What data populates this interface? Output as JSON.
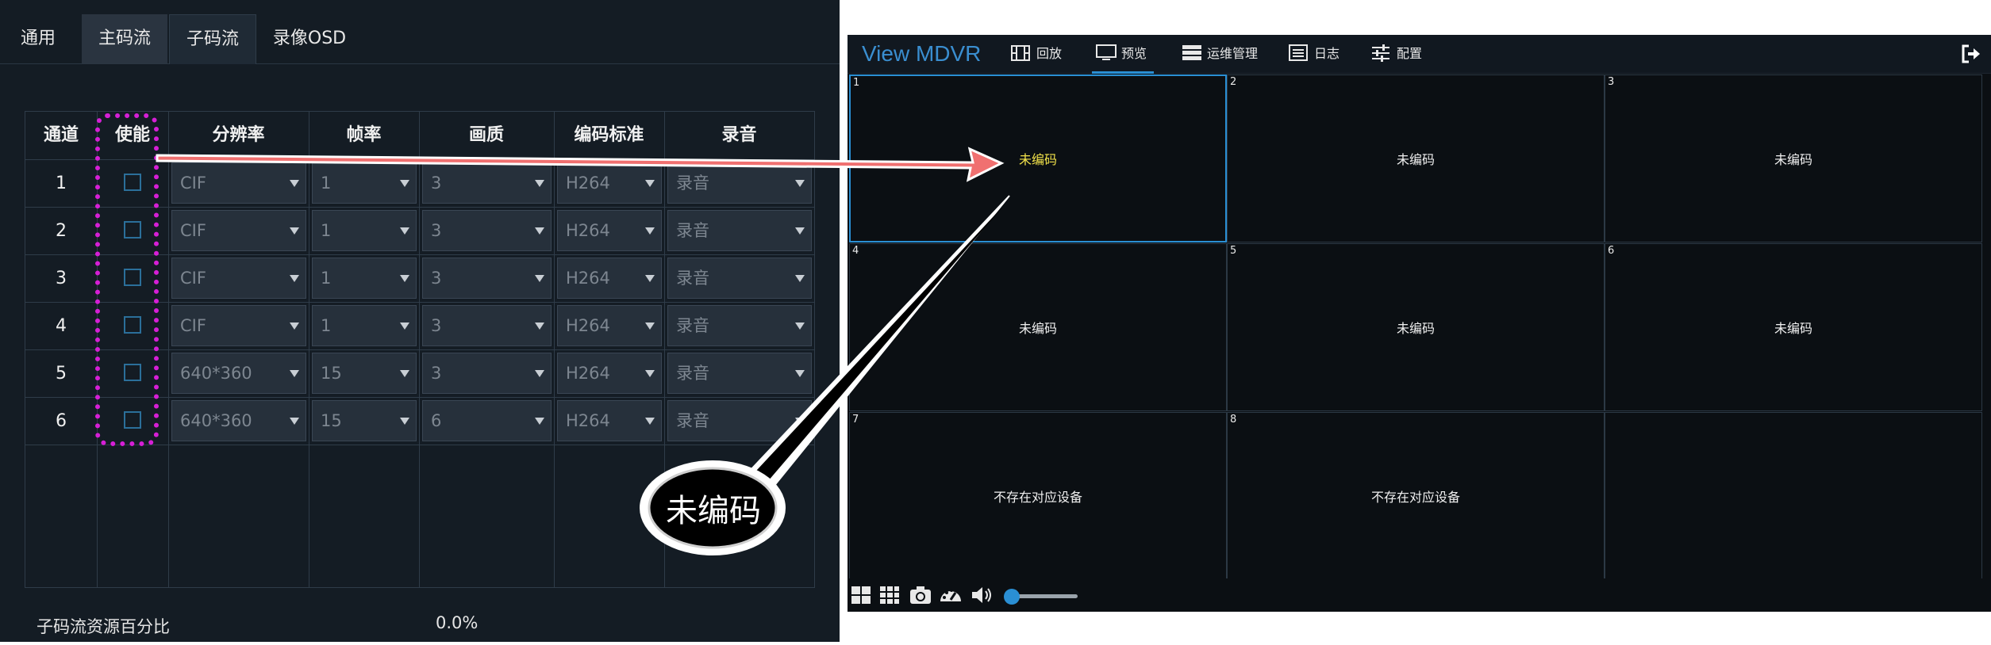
{
  "tabs": [
    "通用",
    "主码流",
    "子码流",
    "录像OSD"
  ],
  "table": {
    "headers": [
      "通道",
      "使能",
      "分辨率",
      "帧率",
      "画质",
      "编码标准",
      "录音"
    ],
    "rows": [
      {
        "ch": "1",
        "res": "CIF",
        "fps": "1",
        "q": "3",
        "enc": "H264",
        "audio": "录音"
      },
      {
        "ch": "2",
        "res": "CIF",
        "fps": "1",
        "q": "3",
        "enc": "H264",
        "audio": "录音"
      },
      {
        "ch": "3",
        "res": "CIF",
        "fps": "1",
        "q": "3",
        "enc": "H264",
        "audio": "录音"
      },
      {
        "ch": "4",
        "res": "CIF",
        "fps": "1",
        "q": "3",
        "enc": "H264",
        "audio": "录音"
      },
      {
        "ch": "5",
        "res": "640*360",
        "fps": "15",
        "q": "3",
        "enc": "H264",
        "audio": "录音"
      },
      {
        "ch": "6",
        "res": "640*360",
        "fps": "15",
        "q": "6",
        "enc": "H264",
        "audio": "录音"
      }
    ]
  },
  "resource": {
    "label": "子码流资源百分比",
    "value": "0.0%"
  },
  "app": {
    "brand": "View MDVR",
    "nav": [
      "回放",
      "预览",
      "运维管理",
      "日志",
      "配置"
    ],
    "cells": [
      {
        "n": "1",
        "text": "未编码"
      },
      {
        "n": "2",
        "text": "未编码"
      },
      {
        "n": "3",
        "text": "未编码"
      },
      {
        "n": "4",
        "text": "未编码"
      },
      {
        "n": "5",
        "text": "未编码"
      },
      {
        "n": "6",
        "text": "未编码"
      },
      {
        "n": "7",
        "text": "不存在对应设备"
      },
      {
        "n": "8",
        "text": "不存在对应设备"
      },
      {
        "n": "",
        "text": ""
      }
    ],
    "volume_level": 0.05
  },
  "callout": {
    "text": "未编码"
  },
  "colors": {
    "accent": "#2a8fd4",
    "highlight_text": "#f2e24a",
    "dash": "#d61fd6",
    "arrow": "#f07070"
  }
}
